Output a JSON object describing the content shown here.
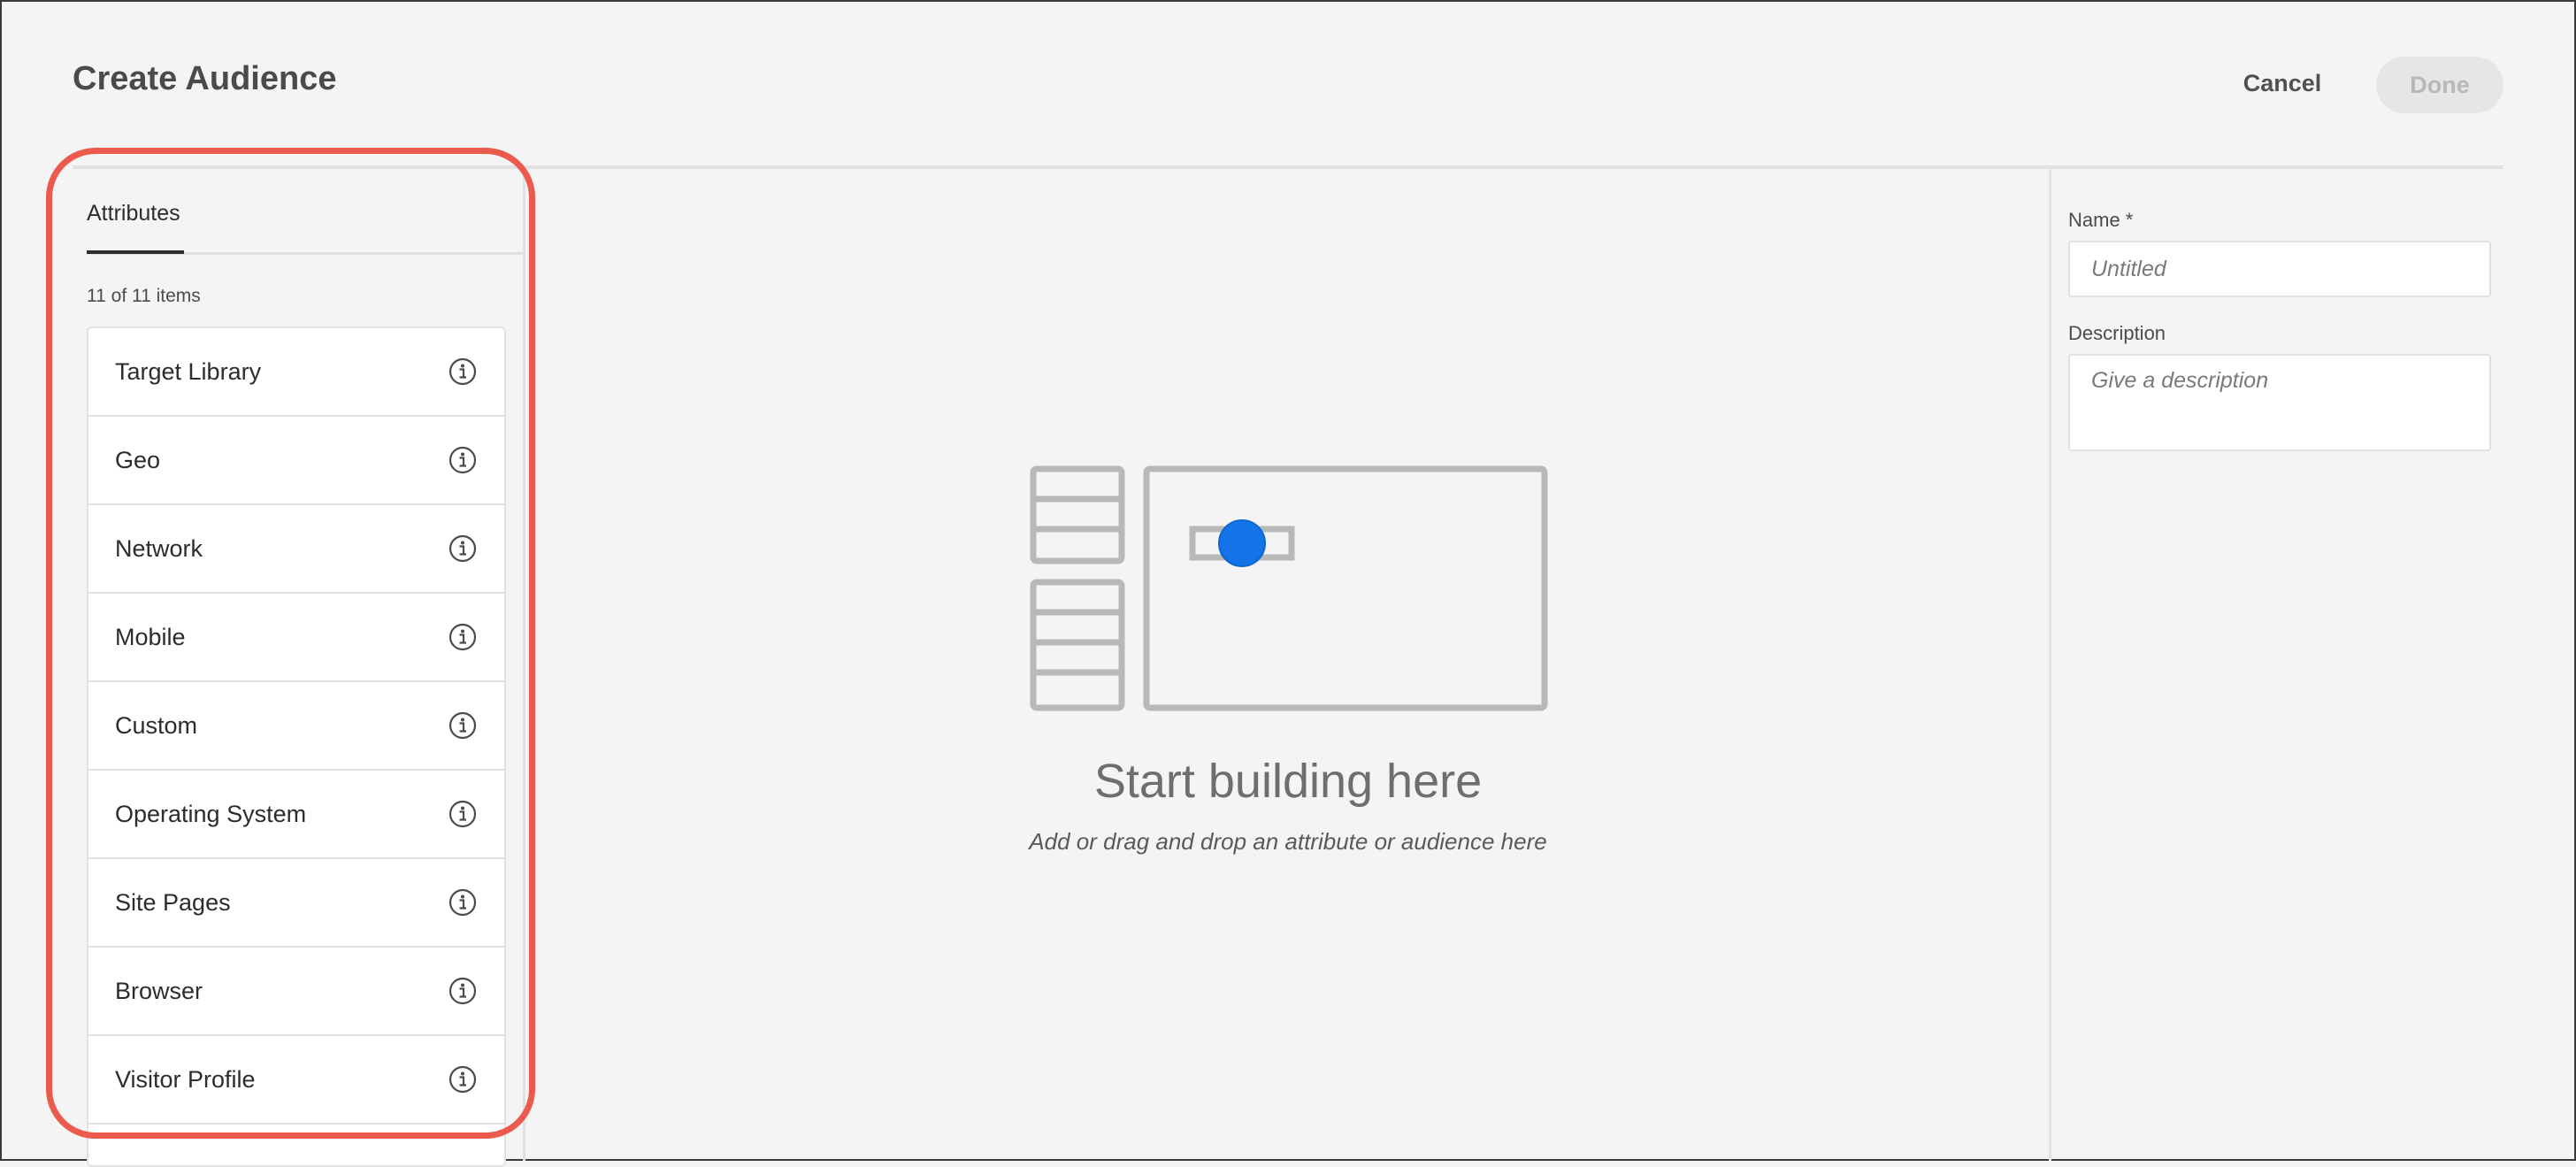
{
  "header": {
    "title": "Create Audience",
    "cancel_label": "Cancel",
    "done_label": "Done"
  },
  "left_panel": {
    "tab_label": "Attributes",
    "item_count": "11 of 11 items",
    "items": [
      {
        "label": "Target Library",
        "icon": "info-icon"
      },
      {
        "label": "Geo",
        "icon": "info-icon"
      },
      {
        "label": "Network",
        "icon": "info-icon"
      },
      {
        "label": "Mobile",
        "icon": "info-icon"
      },
      {
        "label": "Custom",
        "icon": "info-icon"
      },
      {
        "label": "Operating System",
        "icon": "info-icon"
      },
      {
        "label": "Site Pages",
        "icon": "info-icon"
      },
      {
        "label": "Browser",
        "icon": "info-icon"
      },
      {
        "label": "Visitor Profile",
        "icon": "info-icon"
      }
    ]
  },
  "canvas": {
    "empty_title": "Start building here",
    "empty_subtitle": "Add or drag and drop an attribute or audience here"
  },
  "details": {
    "name_label": "Name *",
    "name_placeholder": "Untitled",
    "description_label": "Description",
    "description_placeholder": "Give a description"
  },
  "colors": {
    "highlight": "#ec5a4e",
    "accent_dot": "#1473e6",
    "background": "#f4f4f4"
  }
}
